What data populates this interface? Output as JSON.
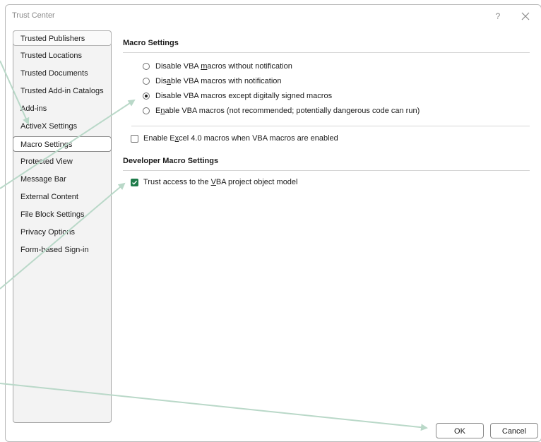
{
  "window": {
    "title": "Trust Center",
    "help": "?"
  },
  "sidebar": {
    "items": [
      {
        "label": "Trusted Publishers"
      },
      {
        "label": "Trusted Locations"
      },
      {
        "label": "Trusted Documents"
      },
      {
        "label": "Trusted Add-in Catalogs"
      },
      {
        "label": "Add-ins"
      },
      {
        "label": "ActiveX Settings"
      },
      {
        "label": "Macro Settings"
      },
      {
        "label": "Protected View"
      },
      {
        "label": "Message Bar"
      },
      {
        "label": "External Content"
      },
      {
        "label": "File Block Settings"
      },
      {
        "label": "Privacy Options"
      },
      {
        "label": "Form-based Sign-in"
      }
    ],
    "selected": "Macro Settings"
  },
  "macro_settings": {
    "heading": "Macro Settings",
    "options": [
      {
        "pre": "Disable VBA ",
        "key": "m",
        "post": "acros without notification",
        "selected": false
      },
      {
        "pre": "Dis",
        "key": "a",
        "post": "ble VBA macros with notification",
        "selected": false
      },
      {
        "pre": "Disable VBA macros except di",
        "key": "g",
        "post": "itally signed macros",
        "selected": true
      },
      {
        "pre": "E",
        "key": "n",
        "post": "able VBA macros (not recommended; potentially dangerous code can run)",
        "selected": false
      }
    ],
    "excel4": {
      "pre": "Enable E",
      "key": "x",
      "post": "cel 4.0 macros when VBA macros are enabled",
      "checked": false
    }
  },
  "developer": {
    "heading": "Developer Macro Settings",
    "trust_vba": {
      "pre": "Trust access to the ",
      "key": "V",
      "post": "BA project object model",
      "checked": true
    }
  },
  "footer": {
    "ok": "OK",
    "cancel": "Cancel"
  },
  "colors": {
    "annotation_arrow": "#b9d8c8",
    "checkbox_checked": "#1e7b4a"
  },
  "icons": {
    "close": "close-icon",
    "check": "check-icon"
  }
}
